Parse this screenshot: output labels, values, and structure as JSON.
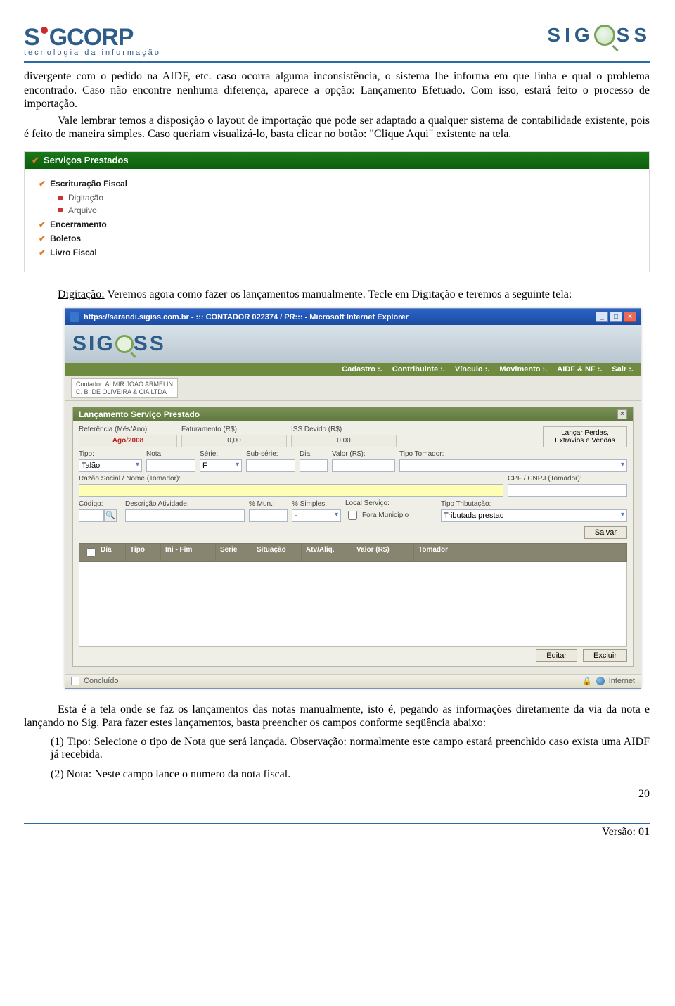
{
  "header": {
    "brand_left": "SiGCORP",
    "brand_left_tag": "tecnologia da informação",
    "brand_right": "SIG  SS"
  },
  "para1": "divergente com o pedido na AIDF, etc. caso ocorra alguma inconsistência, o sistema lhe informa em que linha e qual o problema encontrado. Caso não encontre nenhuma diferença, aparece a opção: Lançamento Efetuado. Com isso, estará feito o processo de importação.",
  "para2": "Vale lembrar temos a disposição o layout de importação que pode ser adaptado a qualquer sistema de contabilidade existente, pois é feito de maneira simples. Caso queriam visualizá-lo, basta clicar no botão: \"Clique Aqui\" existente na tela.",
  "sidebar": {
    "title": "Serviços Prestados",
    "items": [
      {
        "label": "Escrituração Fiscal",
        "children": [
          "Digitação",
          "Arquivo"
        ]
      },
      {
        "label": "Encerramento"
      },
      {
        "label": "Boletos"
      },
      {
        "label": "Livro Fiscal"
      }
    ]
  },
  "para3_lead": "Digitação:",
  "para3_rest": " Veremos agora como fazer os lançamentos manualmente. Tecle em Digitação e teremos a seguinte tela:",
  "window": {
    "title": "https://sarandi.sigiss.com.br - ::: CONTADOR 022374 / PR::: - Microsoft Internet Explorer",
    "app_brand": "SIG  SS",
    "menu": [
      "Cadastro :.",
      "Contribuinte :.",
      "Vínculo :.",
      "Movimento :.",
      "AIDF & NF :.",
      "Sair :."
    ],
    "user_line1": "Contador: ALMIR JOAO ARMELIN",
    "user_line2": "C. B. DE OLIVEIRA & CIA LTDA",
    "panel_title": "Lançamento Serviço Prestado",
    "ref_label": "Referência (Mês/Ano)",
    "fat_label": "Faturamento (R$)",
    "iss_label": "ISS Devido (R$)",
    "ref_value": "Ago/2008",
    "fat_value": "0,00",
    "iss_value": "0,00",
    "sidebutton": "Lançar Perdas, Extravios e Vendas",
    "tipo_label": "Tipo:",
    "tipo_value": "Talão",
    "nota_label": "Nota:",
    "nota_value": "",
    "serie_label": "Série:",
    "serie_value": "F",
    "subserie_label": "Sub-série:",
    "subserie_value": "",
    "dia_label": "Dia:",
    "dia_value": "",
    "valor_label": "Valor (R$):",
    "valor_value": "",
    "tipotom_label": "Tipo Tomador:",
    "tipotom_value": "",
    "razao_label": "Razão Social / Nome (Tomador):",
    "razao_value": "",
    "cpfcnpj_label": "CPF / CNPJ (Tomador):",
    "cpfcnpj_value": "",
    "codigo_label": "Código:",
    "desc_label": "Descrição Atividade:",
    "pmun_label": "% Mun.:",
    "psim_label": "% Simples:",
    "localserv_label": "Local Serviço:",
    "fora_label": "Fora Município",
    "tipotrib_label": "Tipo Tributação:",
    "tipotrib_value": "Tributada prestac",
    "salvar_label": "Salvar",
    "grid_cols": [
      "",
      "Dia",
      "Tipo",
      "Ini - Fim",
      "Serie",
      "Situação",
      "Atv/Aliq.",
      "Valor (R$)",
      "Tomador"
    ],
    "editar_label": "Editar",
    "excluir_label": "Excluir",
    "status_left": "Concluído",
    "status_right": "Internet"
  },
  "para4": "Esta é a tela onde se faz os lançamentos das notas manualmente, isto é, pegando as informações diretamente da via da nota e lançando no Sig. Para fazer estes lançamentos, basta preencher os campos conforme seqüência abaixo:",
  "list": [
    "(1) Tipo: Selecione o tipo de Nota que será lançada. Observação: normalmente este campo estará preenchido caso exista uma AIDF já recebida.",
    "(2) Nota: Neste campo lance o numero da nota fiscal."
  ],
  "page_number": "20",
  "version": "Versão: 01"
}
